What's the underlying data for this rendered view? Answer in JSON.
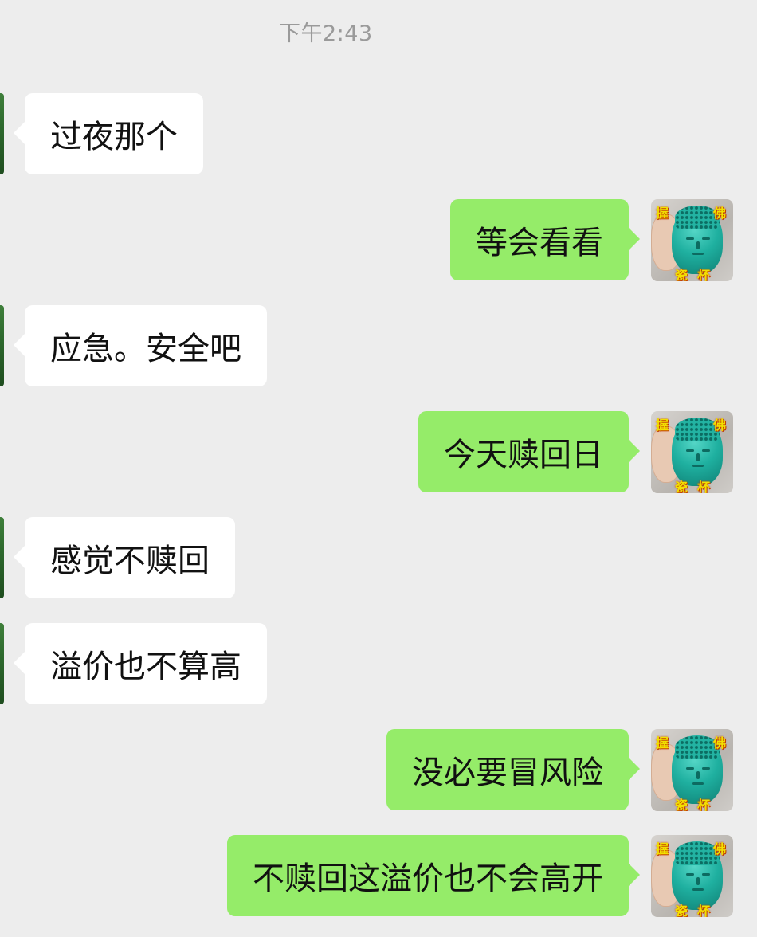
{
  "timestamp": "下午2:43",
  "messages": [
    {
      "side": "left",
      "text": "过夜那个"
    },
    {
      "side": "right",
      "text": "等会看看"
    },
    {
      "side": "left",
      "text": "应急。安全吧"
    },
    {
      "side": "right",
      "text": "今天赎回日"
    },
    {
      "side": "left",
      "text": "感觉不赎回"
    },
    {
      "side": "left",
      "text": "溢价也不算高"
    },
    {
      "side": "right",
      "text": "没必要冒风险"
    },
    {
      "side": "right",
      "text": "不赎回这溢价也不会高开"
    }
  ],
  "avatar": {
    "icon": "buddha-cup-avatar-icon",
    "chars": [
      "握",
      "佛",
      "瓷",
      "杯"
    ]
  },
  "colors": {
    "background": "#EDEDED",
    "bubble_left": "#FFFFFF",
    "bubble_right": "#95EC69",
    "timestamp": "#9A9A9A"
  }
}
